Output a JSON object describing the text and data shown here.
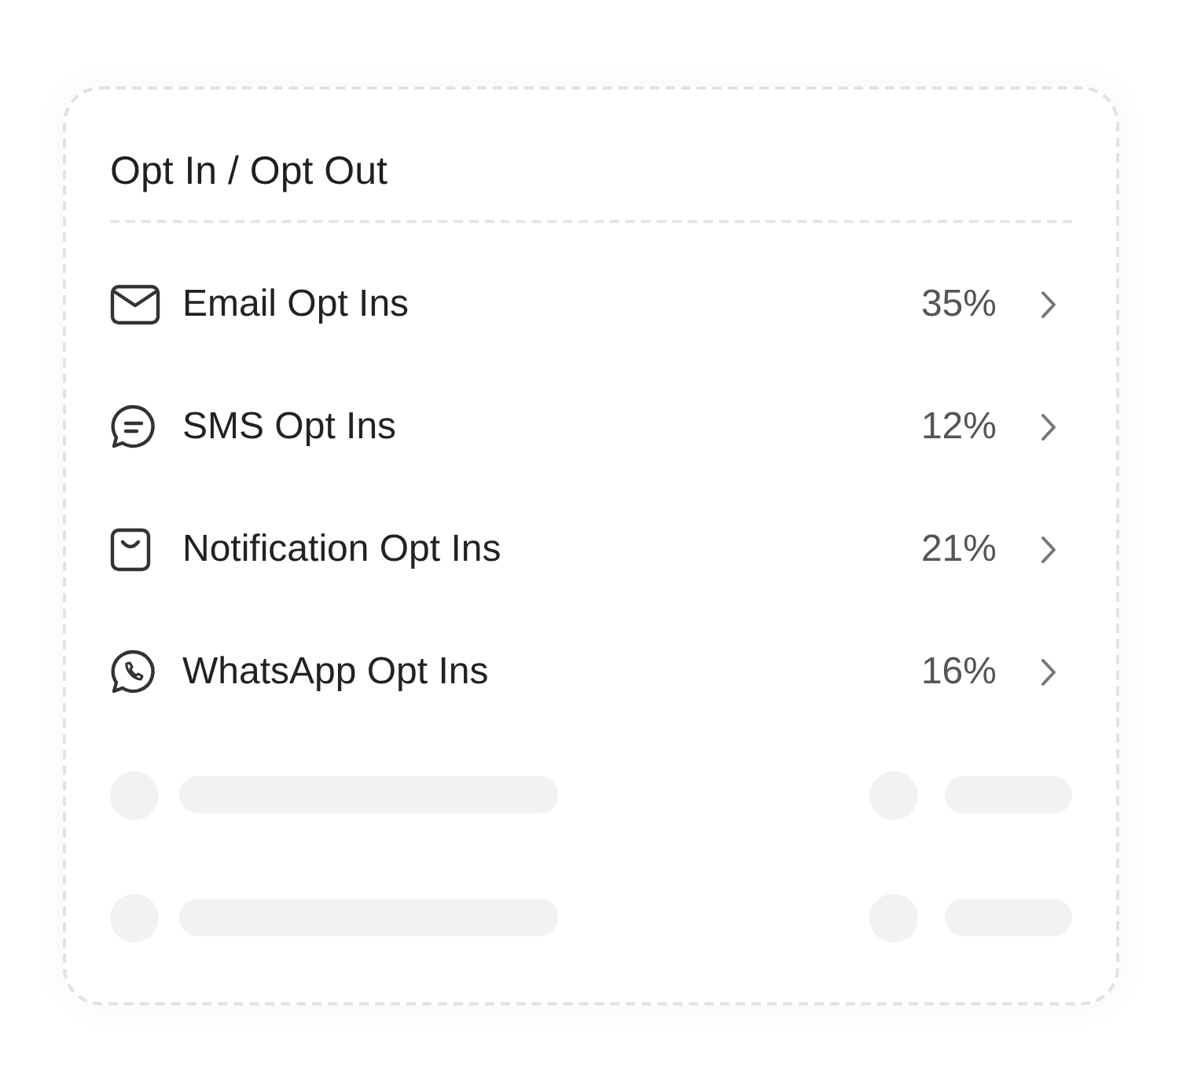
{
  "card": {
    "title": "Opt In / Opt Out"
  },
  "items": [
    {
      "kind": "email",
      "label": "Email Opt Ins",
      "value": "35%"
    },
    {
      "kind": "sms",
      "label": "SMS Opt Ins",
      "value": "12%"
    },
    {
      "kind": "notification",
      "label": "Notification Opt Ins",
      "value": "21%"
    },
    {
      "kind": "whatsapp",
      "label": "WhatsApp Opt Ins",
      "value": "16%"
    }
  ],
  "loading_rows": [
    {
      "kind": "skeleton"
    },
    {
      "kind": "skeleton"
    }
  ]
}
